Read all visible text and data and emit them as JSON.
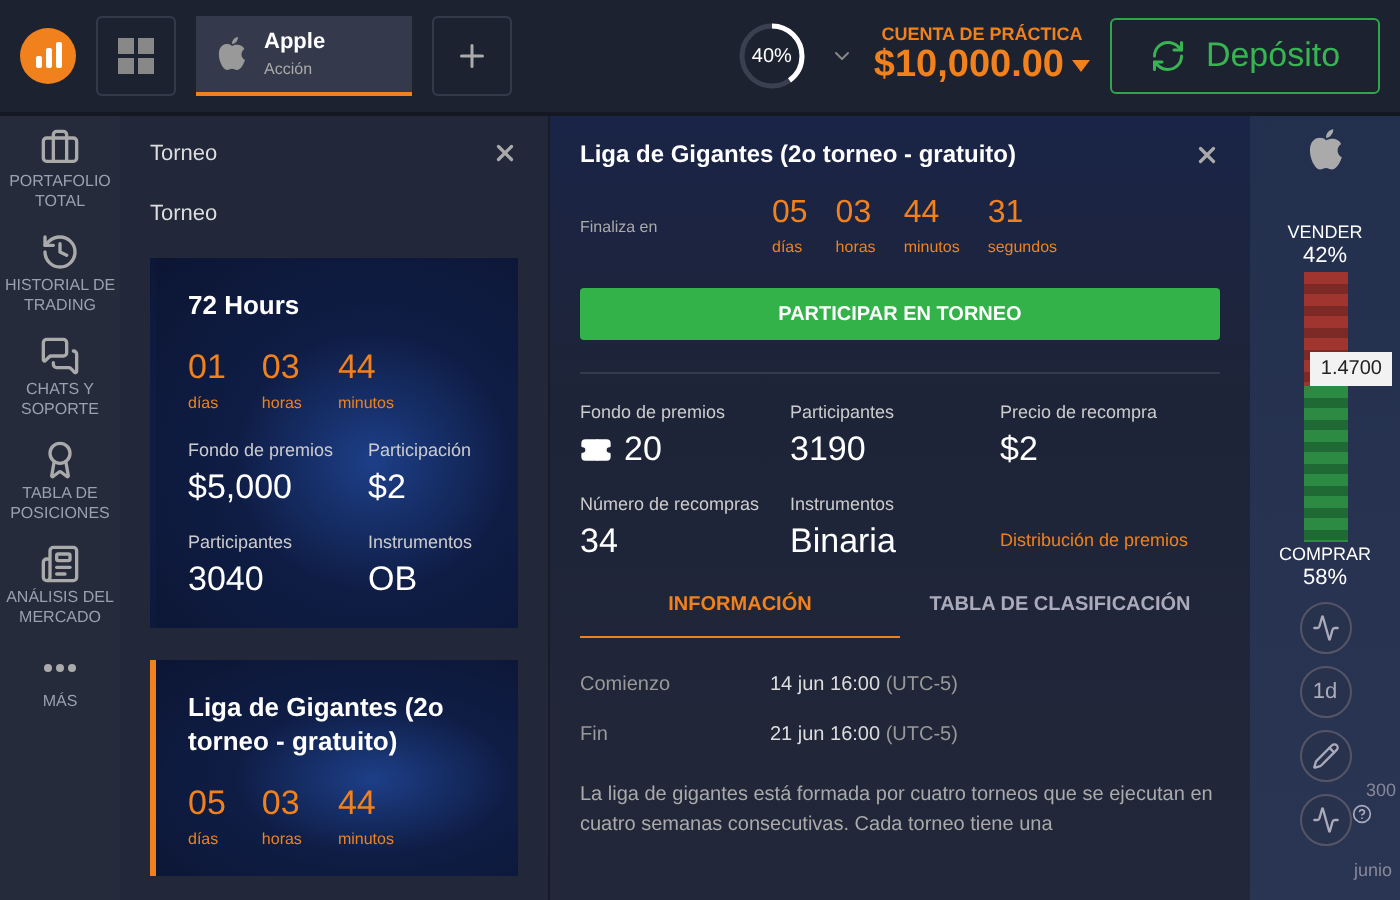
{
  "header": {
    "asset_tabs": [
      {
        "name": "Apple",
        "sub": "Acción",
        "selected": true
      }
    ],
    "progress": {
      "label": "40%",
      "level": 0.4
    },
    "account": {
      "label": "CUENTA DE PRÁCTICA",
      "balance": "$10,000.00"
    },
    "deposit": "Depósito"
  },
  "sidebar": {
    "items": [
      {
        "label": "PORTAFOLIO TOTAL",
        "kind": "briefcase"
      },
      {
        "label": "HISTORIAL DE TRADING",
        "kind": "history"
      },
      {
        "label": "CHATS Y SOPORTE",
        "kind": "chat"
      },
      {
        "label": "TABLA DE POSICIONES",
        "kind": "medal"
      },
      {
        "label": "ANÁLISIS DEL MERCADO",
        "kind": "news"
      },
      {
        "label": "MÁS",
        "kind": "more"
      }
    ]
  },
  "list": {
    "title": "Torneo",
    "subtitle": "Torneo",
    "tournaments": [
      {
        "name": "72 Hours",
        "selected": false,
        "countdown": [
          {
            "value": "01",
            "unit": "días"
          },
          {
            "value": "03",
            "unit": "horas"
          },
          {
            "value": "44",
            "unit": "minutos"
          }
        ],
        "stats": [
          {
            "label": "Fondo de premios",
            "value": "$5,000"
          },
          {
            "label": "Participación",
            "value": "$2"
          },
          {
            "label": "Participantes",
            "value": "3040"
          },
          {
            "label": "Instrumentos",
            "value": "OB"
          }
        ]
      },
      {
        "name": "Liga de Gigantes (2o torneo - gratuito)",
        "selected": true,
        "countdown": [
          {
            "value": "05",
            "unit": "días"
          },
          {
            "value": "03",
            "unit": "horas"
          },
          {
            "value": "44",
            "unit": "minutos"
          }
        ]
      }
    ]
  },
  "detail": {
    "title": "Liga de Gigantes (2o torneo - gratuito)",
    "ends_label": "Finaliza en",
    "countdown": [
      {
        "value": "05",
        "unit": "días"
      },
      {
        "value": "03",
        "unit": "horas"
      },
      {
        "value": "44",
        "unit": "minutos"
      },
      {
        "value": "31",
        "unit": "segundos"
      }
    ],
    "join_button": "PARTICIPAR EN TORNEO",
    "stats": [
      {
        "label": "Fondo de premios",
        "value": "20",
        "kind": "ticket"
      },
      {
        "label": "Participantes",
        "value": "3190",
        "kind": "plain"
      },
      {
        "label": "Precio de recompra",
        "value": "$2",
        "kind": "plain"
      },
      {
        "label": "Número de recompras",
        "value": "34",
        "kind": "plain"
      },
      {
        "label": "Instrumentos",
        "value": "Binaria",
        "kind": "plain"
      }
    ],
    "prize_link": "Distribución de premios",
    "tabs": [
      {
        "label": "INFORMACIÓN",
        "selected": true
      },
      {
        "label": "TABLA DE CLASIFICACIÓN",
        "selected": false
      }
    ],
    "info": [
      {
        "label": "Comienzo",
        "value": "14 jun 16:00",
        "tz": "(UTC-5)"
      },
      {
        "label": "Fin",
        "value": "21 jun 16:00",
        "tz": "(UTC-5)"
      }
    ],
    "description": "La liga de gigantes está formada por cuatro torneos que se ejecutan en cuatro semanas consecutivas. Cada torneo tiene una"
  },
  "chart": {
    "sell_label": "VENDER",
    "sell_pct": "42%",
    "buy_label": "COMPRAR",
    "buy_pct": "58%",
    "level": 0.42,
    "price": "1.4700",
    "tools": [
      {
        "kind": "chart"
      },
      {
        "kind": "text",
        "label": "1d"
      },
      {
        "kind": "pencil"
      },
      {
        "kind": "wave"
      }
    ],
    "axis_value": "300",
    "month": "junio"
  }
}
